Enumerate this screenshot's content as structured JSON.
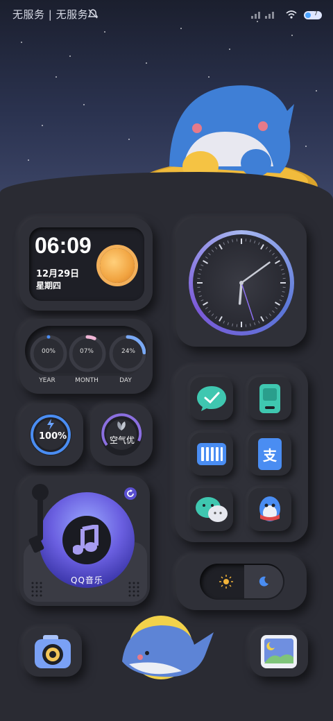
{
  "status_bar": {
    "carrier": "无服务 | 无服务",
    "battery_level": "7"
  },
  "time_widget": {
    "time": "06:09",
    "date": "12月29日",
    "weekday": "星期四"
  },
  "progress_widget": {
    "rings": [
      {
        "value": "00%",
        "label": "YEAR",
        "percent": 0
      },
      {
        "value": "07%",
        "label": "MONTH",
        "percent": 7
      },
      {
        "value": "24%",
        "label": "DAY",
        "percent": 24
      }
    ]
  },
  "battery_widget": {
    "value": "100%",
    "percent": 100
  },
  "air_widget": {
    "value": "空气优"
  },
  "clock_widget": {
    "hour": 6,
    "minute": 9,
    "second": 17
  },
  "music_widget": {
    "label": "QQ音乐"
  },
  "apps": [
    {
      "name": "todo-app-icon"
    },
    {
      "name": "scanner-app-icon"
    },
    {
      "name": "keyboard-app-icon"
    },
    {
      "name": "alipay-app-icon",
      "glyph": "支"
    },
    {
      "name": "wechat-app-icon"
    },
    {
      "name": "qq-app-icon"
    }
  ],
  "theme_toggle": {
    "mode": "night"
  },
  "dock": [
    {
      "name": "camera-app-icon"
    },
    {
      "name": "gallery-app-icon"
    }
  ],
  "colors": {
    "background": "#2a2b33",
    "accent_blue": "#4a8df2",
    "accent_purple": "#7a5ae0"
  }
}
